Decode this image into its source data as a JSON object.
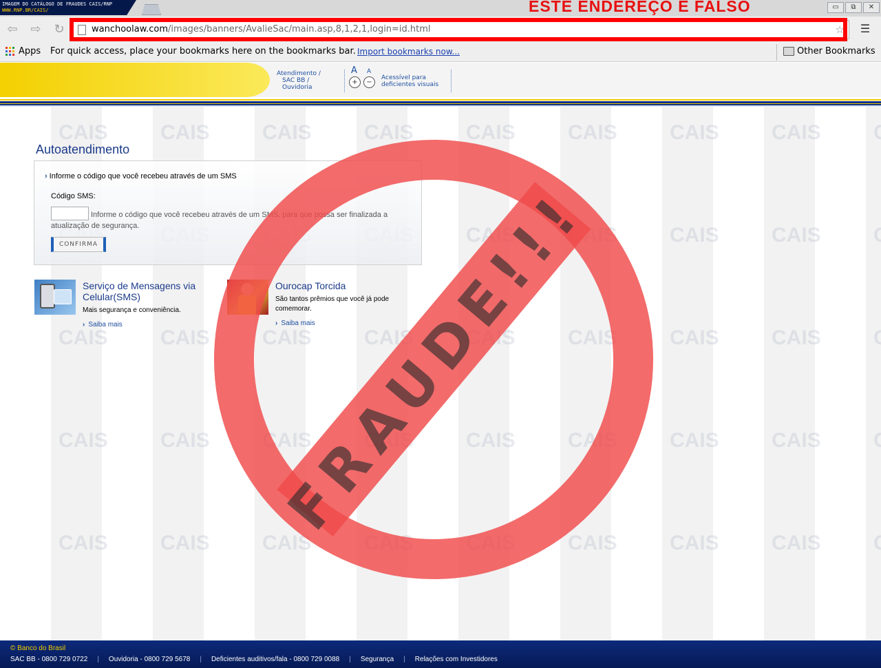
{
  "browser": {
    "tab_line1": "IMAGEM DO CATÁLOGO DE FRAUDES CAIS/RNP",
    "tab_line2": "WWW.RNP.BR/CAIS/",
    "warning_banner": "ESTE ENDEREÇO É FALSO",
    "url_host": "wanchoolaw.com",
    "url_path": "/images/banners/AvalieSac/main.asp,8,1,2,1,login=id.html",
    "window_controls": {
      "minimize": "▭",
      "restore": "⧉",
      "close": "✕"
    },
    "nav_icons": [
      "back-icon",
      "forward-icon",
      "reload-icon"
    ],
    "highlight_color": "#ff0000"
  },
  "bookmarks_bar": {
    "apps_label": "Apps",
    "hint": "For quick access, place your bookmarks here on the bookmarks bar.",
    "import_link": "Import bookmarks now...",
    "other_bookmarks": "Other Bookmarks"
  },
  "header": {
    "attendance_link_line1": "Atendimento /",
    "attendance_link_line2": "SAC BB /",
    "attendance_link_line3": "Ouvidoria",
    "font_big": "A",
    "font_small": "A",
    "font_plus": "+",
    "font_minus": "−",
    "accessible_line1": "Acessível para",
    "accessible_line2": "deficientes visuais",
    "brand_yellow": "#f3d000",
    "brand_blue": "#0a2f87"
  },
  "main": {
    "title": "Autoatendimento",
    "sms_info": "Informe o código que você recebeu através de um SMS",
    "sms_label": "Código SMS:",
    "sms_input_value": "",
    "sms_help": "Informe o código que você recebeu através de um SMS, para que possa ser finalizada a atualização de segurança.",
    "confirm_button": "CONFIRMA"
  },
  "promos": [
    {
      "title": "Serviço de Mensagens via Celular(SMS)",
      "desc": "Mais segurança e conveniência.",
      "link": "Saiba mais"
    },
    {
      "title": "Ourocap Torcida",
      "desc": "São tantos prêmios que você já pode comemorar.",
      "link": "Saiba mais"
    }
  ],
  "stamp": {
    "text": "FRAUDE!!!",
    "color": "#f04a4a"
  },
  "watermark_text": "CAIS",
  "footer": {
    "copyright": "© Banco do Brasil",
    "links": [
      "SAC BB - 0800 729 0722",
      "Ouvidoria - 0800 729 5678",
      "Deficientes auditivos/fala - 0800 729 0088",
      "Segurança",
      "Relações com Investidores"
    ]
  }
}
